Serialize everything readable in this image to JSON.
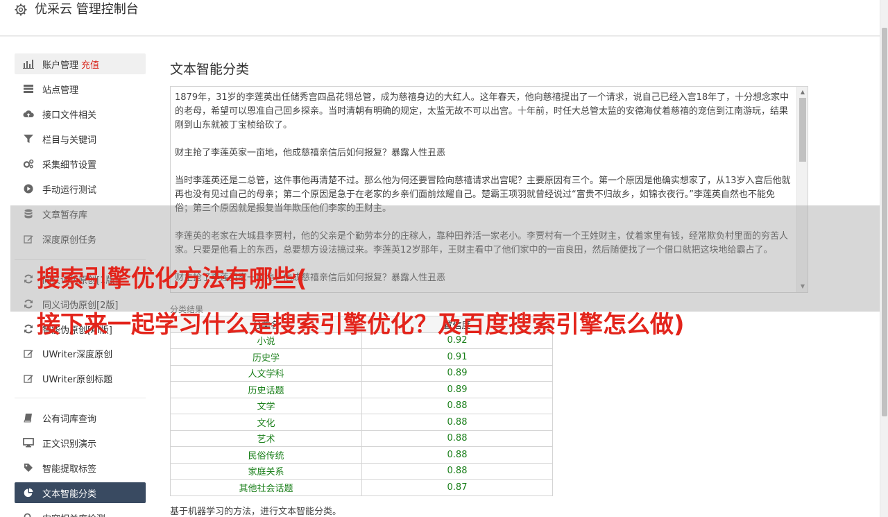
{
  "app": {
    "title": "优采云 管理控制台"
  },
  "sidebar": {
    "items": [
      {
        "label": "账户管理",
        "extra": "充值",
        "icon": "bar-chart-icon"
      },
      {
        "label": "站点管理",
        "icon": "server-icon"
      },
      {
        "label": "接口文件相关",
        "icon": "cloud-upload-icon"
      },
      {
        "label": "栏目与关键词",
        "icon": "filter-icon"
      },
      {
        "label": "采集细节设置",
        "icon": "gears-icon"
      },
      {
        "label": "手动运行测试",
        "icon": "play-circle-icon"
      },
      {
        "label": "文章暂存库",
        "icon": "database-icon"
      },
      {
        "label": "深度原创任务",
        "icon": "edit-icon"
      },
      {
        "label": "同义词伪原创[1版]",
        "icon": "refresh-icon"
      },
      {
        "label": "同义词伪原创[2版]",
        "icon": "refresh-icon"
      },
      {
        "label": "智能伪原创[AI版]",
        "icon": "refresh-icon"
      },
      {
        "label": "UWriter深度原创",
        "icon": "edit-icon"
      },
      {
        "label": "UWriter原创标题",
        "icon": "edit-icon"
      },
      {
        "label": "公有词库查询",
        "icon": "book-icon"
      },
      {
        "label": "正文识别演示",
        "icon": "monitor-icon"
      },
      {
        "label": "智能提取标签",
        "icon": "tag-icon"
      },
      {
        "label": "文本智能分类",
        "icon": "pie-chart-icon"
      },
      {
        "label": "内容相关度检测",
        "icon": "search-icon"
      }
    ]
  },
  "main": {
    "title": "文本智能分类",
    "text_paragraphs": [
      "1879年，31岁的李莲英出任储秀宫四品花翎总管，成为慈禧身边的大红人。这年春天，他向慈禧提出了一个请求，说自己已经入宫18年了，十分想念家中的老母，希望可以恩准自己回乡探亲。当时清朝有明确的规定，太监无故不可以出宫。十年前，时任大总管太监的安德海仗着慈禧的宠信到江南游玩，结果刚到山东就被丁宝桢给砍了。",
      "财主抢了李莲英家一亩地，他成慈禧亲信后如何报复？暴露人性丑恶",
      "当时李莲英还是二总管，这件事他再清楚不过。那么他为何还要冒险向慈禧请求出宫呢？主要原因有三个。第一个原因是他确实想家了，从13岁入宫后他就再也没有见过自己的母亲；第二个原因是急于在老家的乡亲们面前炫耀自己。楚霸王项羽就曾经说过“富贵不归故乡，如锦衣夜行。”李莲英自然也不能免俗；第三个原因就是报复当年欺压他们李家的王财主。",
      "李莲英的老家在大城县李贾村，他的父亲是个勤劳本分的庄稼人，靠种田养活一家老小。李贾村有一个王姓财主，仗着家里有钱，经常欺负村里面的穷苦人家。只要是他看上的东西，总要想方设法搞过来。李莲英12岁那年，王财主看中了他们家中的一亩良田，然后随便找了一个借口就把这块地给霸占了。",
      "财主抢了李莲英家一亩地，他成慈禧亲信后如何报复？暴露人性丑恶"
    ],
    "result_label": "分类结果",
    "table": {
      "headers": [
        "分类名",
        "置信度"
      ],
      "rows": [
        [
          "小说",
          "0.92"
        ],
        [
          "历史学",
          "0.91"
        ],
        [
          "人文学科",
          "0.89"
        ],
        [
          "历史话题",
          "0.89"
        ],
        [
          "文学",
          "0.88"
        ],
        [
          "文化",
          "0.88"
        ],
        [
          "艺术",
          "0.88"
        ],
        [
          "民俗传统",
          "0.88"
        ],
        [
          "家庭关系",
          "0.88"
        ],
        [
          "其他社会话题",
          "0.87"
        ]
      ]
    },
    "description": "基于机器学习的方法，进行文本智能分类。"
  },
  "overlay": {
    "line1": "搜索引擎优化方法有哪些(",
    "line2": "接下来一起学习什么是搜索引擎优化？及百度搜索引擎怎么做)"
  },
  "colors": {
    "accent": "#394a61",
    "overlay_text": "#e3241b",
    "highlight": "#d9261c",
    "confidence": "#1a7f1a"
  }
}
